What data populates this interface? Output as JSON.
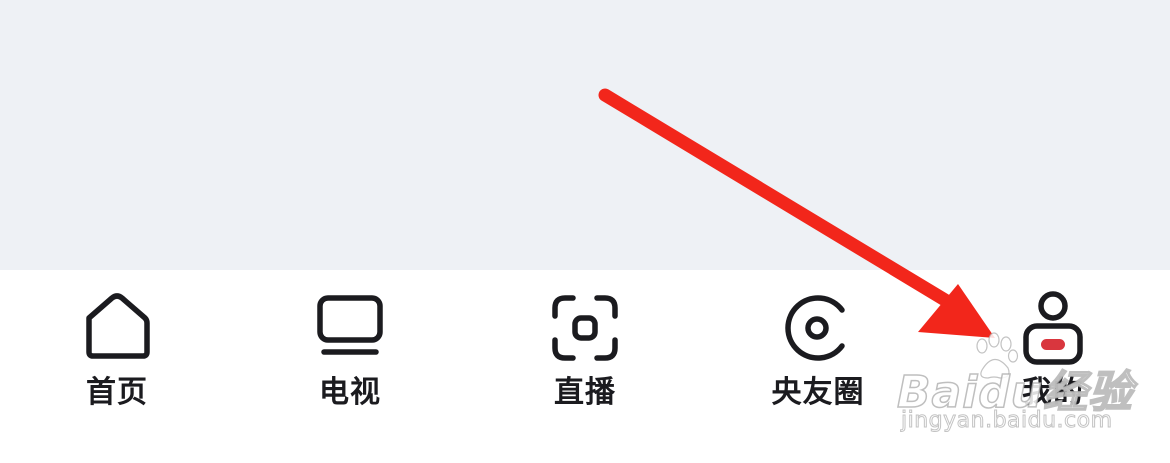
{
  "tabbar": {
    "tabs": [
      {
        "id": "home",
        "label": "首页",
        "icon": "home-icon"
      },
      {
        "id": "tv",
        "label": "电视",
        "icon": "tv-icon"
      },
      {
        "id": "live",
        "label": "直播",
        "icon": "live-focus-icon"
      },
      {
        "id": "circle",
        "label": "央友圈",
        "icon": "circle-icon"
      },
      {
        "id": "mine",
        "label": "我的",
        "icon": "user-profile-icon"
      }
    ]
  },
  "colors": {
    "content_background": "#eef1f5",
    "tabbar_background": "#ffffff",
    "icon_stroke": "#1b1b1f",
    "profile_badge": "#d9363e",
    "annotation_arrow": "#f2261b"
  },
  "watermark": {
    "brand": "Baidu经验",
    "url": "jingyan.baidu.com"
  }
}
